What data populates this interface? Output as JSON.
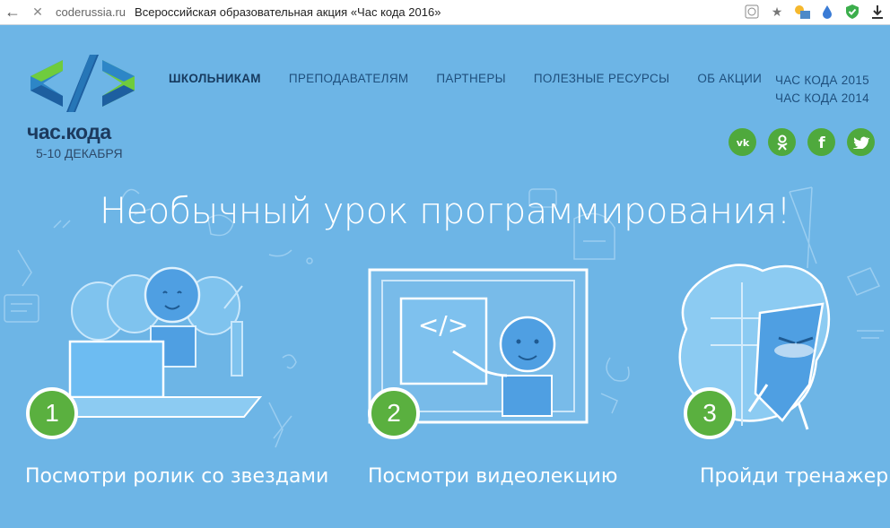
{
  "browser": {
    "domain": "coderussia.ru",
    "page_title": "Всероссийская образовательная акция «Час кода 2016»"
  },
  "logo": {
    "name": "час.кода",
    "dates": "5-10 ДЕКАБРЯ"
  },
  "nav": {
    "items": [
      "ШКОЛЬНИКАМ",
      "ПРЕПОДАВАТЕЛЯМ",
      "ПАРТНЕРЫ",
      "ПОЛЕЗНЫЕ РЕСУРСЫ",
      "ОБ АКЦИИ"
    ],
    "archive": [
      "ЧАС КОДА 2015",
      "ЧАС КОДА 2014"
    ]
  },
  "social": {
    "vk": "vk",
    "ok": "ok",
    "fb": "f",
    "tw": "tw"
  },
  "hero": {
    "headline": "Необычный урок программирования!",
    "code_symbol": "</>"
  },
  "steps": [
    {
      "number": "1",
      "label": "Посмотри ролик со звездами"
    },
    {
      "number": "2",
      "label": "Посмотри видеолекцию"
    },
    {
      "number": "3",
      "label": "Пройди тренажер"
    }
  ],
  "colors": {
    "background": "#6db5e6",
    "accent_green": "#5ab03f",
    "nav_text": "#1e4f7d"
  }
}
